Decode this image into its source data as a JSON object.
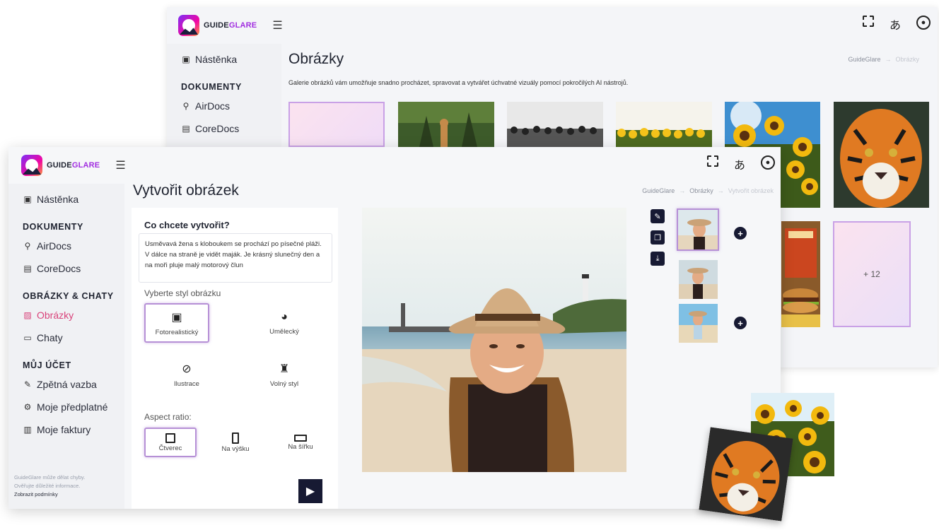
{
  "brand": {
    "part1": "GUIDE",
    "part2": "GLARE"
  },
  "top_icons": [
    "fullscreen-icon",
    "translate-icon",
    "user-icon"
  ],
  "back_window": {
    "sidebar": {
      "items": [
        {
          "label": "Nástěnka",
          "icon": "dashboard-icon"
        }
      ],
      "section_documents": "DOKUMENTY",
      "doc_items": [
        {
          "label": "AirDocs",
          "icon": "pin-icon"
        },
        {
          "label": "CoreDocs",
          "icon": "docs-icon"
        }
      ]
    },
    "title": "Obrázky",
    "breadcrumb": [
      "GuideGlare",
      "Obrázky"
    ],
    "description": "Galerie obrázků vám umožňuje snadno procházet, spravovat a vytvářet úchvatné vizuály pomocí pokročilých AI nástrojů.",
    "more_count": "+ 12"
  },
  "front_window": {
    "sidebar": {
      "dashboard": "Nástěnka",
      "section_documents": "DOKUMENTY",
      "airdocs": "AirDocs",
      "coredocs": "CoreDocs",
      "section_images": "OBRÁZKY & CHATY",
      "images": "Obrázky",
      "chats": "Chaty",
      "section_account": "MŮJ ÚČET",
      "feedback": "Zpětná vazba",
      "subscriptions": "Moje předplatné",
      "invoices": "Moje faktury",
      "footer_line1": "GuideGlare může dělat chyby.",
      "footer_line2": "Ověřujte důležité informace.",
      "footer_link": "Zobrazit podmínky"
    },
    "title": "Vytvořit obrázek",
    "breadcrumb": [
      "GuideGlare",
      "Obrázky",
      "Vytvořit obrázek"
    ],
    "question": "Co chcete vytvořit?",
    "prompt": "Usměvavá žena s kloboukem se prochází po písečné pláži. V dálce na straně je vidět maják. Je krásný slunečný den a na moři pluje malý motorový člun",
    "style_label": "Vyberte styl obrázku",
    "styles": [
      {
        "label": "Fotorealistický",
        "icon": "photo-icon",
        "selected": true
      },
      {
        "label": "Umělecký",
        "icon": "palette-icon",
        "selected": false
      },
      {
        "label": "Ilustrace",
        "icon": "pen-icon",
        "selected": false
      },
      {
        "label": "Volný styl",
        "icon": "robot-icon",
        "selected": false
      }
    ],
    "aspect_label": "Aspect ratio:",
    "aspects": [
      {
        "label": "Čtverec",
        "selected": true
      },
      {
        "label": "Na výšku",
        "selected": false
      },
      {
        "label": "Na šířku",
        "selected": false
      }
    ]
  }
}
